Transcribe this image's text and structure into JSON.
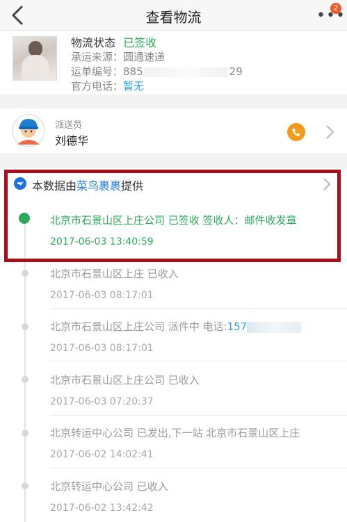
{
  "navbar": {
    "title": "查看物流",
    "back_icon": "chevron-left-icon",
    "more_icon": "more-dots-icon",
    "badge_count": "2"
  },
  "package": {
    "status_label": "物流状态",
    "status_value": "已签收",
    "carrier_label": "承运来源：",
    "carrier_value": "圆通速递",
    "tracking_label": "运单编号：",
    "tracking_prefix": "885",
    "tracking_suffix": "29",
    "phone_label": "官方电话：",
    "phone_value": "暂无"
  },
  "courier": {
    "role": "派送员",
    "name": "刘德华",
    "phone_icon": "phone-icon",
    "chevron_icon": "chevron-right-icon"
  },
  "provider": {
    "prefix": "本数据由",
    "link": "菜鸟裹裹",
    "suffix": "提供",
    "logo_icon": "cainiao-logo-icon"
  },
  "timeline": [
    {
      "text": "北京市石景山区上庄公司 已签收 签收人：邮件收发章",
      "time": "2017-06-03 13:40:59"
    },
    {
      "text": "北京市石景山区上庄 已收入",
      "time": "2017-06-03 08:17:01"
    },
    {
      "text": "北京市石景山区上庄公司 派件中 电话:",
      "phone_visible": "157",
      "time": "2017-06-03 08:17:01"
    },
    {
      "text": "北京市石景山区上庄公司 已收入",
      "time": "2017-06-03 07:20:37"
    },
    {
      "text": "北京转运中心公司 已发出,下一站 北京市石景山区上庄",
      "time": "2017-06-02 14:02:41"
    },
    {
      "text": "北京转运中心公司 已收入",
      "time": "2017-06-02 13:42:42"
    }
  ],
  "colors": {
    "green": "#2ca85a",
    "blue": "#2a9fd8",
    "highlight": "#a80f1c",
    "badge": "#f05a28",
    "phone": "#f29a1b"
  }
}
